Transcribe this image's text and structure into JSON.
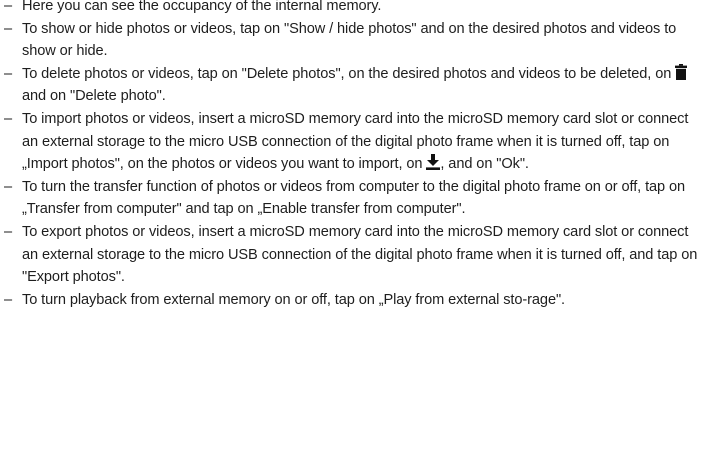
{
  "bullet_symbol": "–",
  "icons": {
    "trash": "trash-icon",
    "download": "download-icon"
  },
  "items": [
    {
      "text": "Here you can see the occupancy of the internal memory."
    },
    {
      "text": "To show or hide photos or videos, tap on \"Show / hide photos\" and on the desired photos and videos to show or hide."
    },
    {
      "text_before": "To delete photos or videos, tap on \"Delete photos\", on the desired photos and videos to be deleted, on ",
      "text_after": " and on \"Delete photo\"."
    },
    {
      "text_before": "To import photos or videos, insert a microSD memory card into the microSD memory card slot or connect an external storage to the micro USB connection of the digital photo frame when it is turned off, tap on „Import photos\", on the photos or videos you want to import, on ",
      "text_after": ", and on \"Ok\"."
    },
    {
      "text": "To turn the transfer function of photos or videos from computer to the digital photo frame on or off, tap on „Transfer from computer\" and tap on „Enable transfer from computer\"."
    },
    {
      "text": "To export photos or videos, insert a microSD memory card into the microSD memory card slot or connect an external storage to the micro USB connection of the digital photo frame when it is turned off, and tap on \"Export photos\"."
    },
    {
      "text": "To turn playback from external memory on or off, tap on „Play from external sto-rage\"."
    }
  ]
}
